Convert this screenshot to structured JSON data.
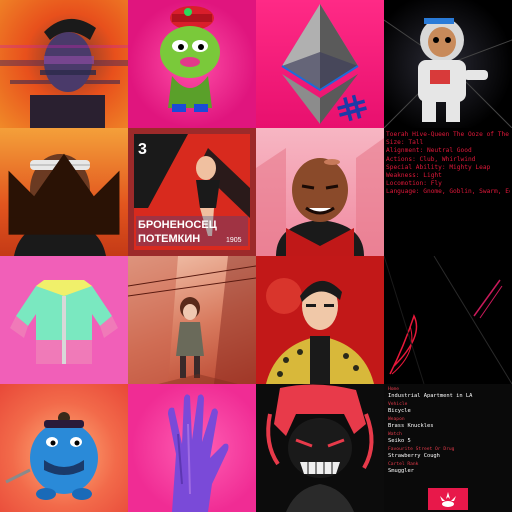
{
  "gallery": {
    "tiles": [
      {
        "icon": "glitch-portrait-icon"
      },
      {
        "icon": "green-cartoon-character-icon"
      },
      {
        "icon": "ethereum-logo-icon",
        "badge_icon": "hashtag-icon"
      },
      {
        "icon": "astronaut-skeleton-icon"
      },
      {
        "icon": "man-headband-portrait-icon",
        "badge_icon": "crown-icon"
      },
      {
        "icon": "vintage-poster-icon",
        "poster_number": "3",
        "poster_text_line1": "БРОНЕНОСЕЦ",
        "poster_text_line2": "ПОТЕМКИН",
        "poster_year": "1905"
      },
      {
        "icon": "bald-cartoon-man-icon"
      },
      {
        "icon": "character-lore-text"
      },
      {
        "icon": "jacket-icon"
      },
      {
        "icon": "anime-girl-street-icon"
      },
      {
        "icon": "anime-man-leopard-jacket-icon"
      },
      {
        "icon": "abstract-red-lines-icon"
      },
      {
        "icon": "blue-monster-icon"
      },
      {
        "icon": "purple-hand-icon"
      },
      {
        "icon": "dreadlock-monster-icon"
      },
      {
        "icon": "character-card-text",
        "logo_icon": "claw-logo-icon"
      }
    ]
  },
  "lore": {
    "lines": [
      "Toerah Hive-Queen The Ooze of The Swamp",
      "Size: Tall",
      "Alignment: Neutral Good",
      "Actions: Club, Whirlwind",
      "Special Ability: Mighty Leap",
      "Weakness: Light",
      "Locomotion: Fly",
      "Language: Gnome, Goblin, Swarm, Ecira, Pes"
    ]
  },
  "card": {
    "fields": [
      {
        "label": "Home",
        "value": "Industrial Apartment in LA"
      },
      {
        "label": "Vehicle",
        "value": "Bicycle"
      },
      {
        "label": "Weapon",
        "value": "Brass Knuckles"
      },
      {
        "label": "Watch",
        "value": "Seiko 5"
      },
      {
        "label": "Favourite Street Or Drug",
        "value": "Strawberry Cough"
      },
      {
        "label": "Cartel Rank",
        "value": "Smuggler"
      }
    ]
  },
  "colors": {
    "lore_text": "#e0183a",
    "card_label": "#e23a4a",
    "accent_pink": "#f02c94"
  }
}
